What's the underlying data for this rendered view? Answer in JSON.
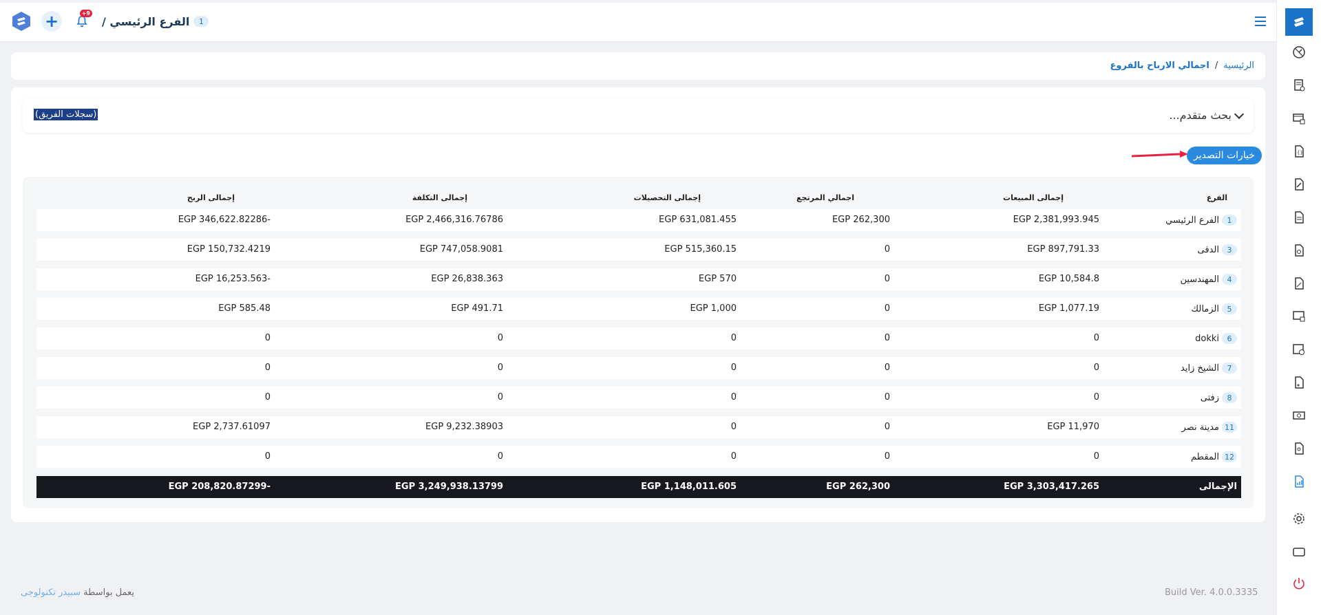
{
  "header": {
    "branch_number": "1",
    "branch_title": "الفرع الرئيسي /",
    "notification_count": "+9",
    "add_symbol": "+"
  },
  "breadcrumb": {
    "home": "الرئيسية",
    "separator": "/",
    "current": "اجمالي الارباح بالفروع"
  },
  "search": {
    "advanced_label": "بحث متقدم...",
    "team_logs": "(سجلات الفريق)"
  },
  "export_button": "خيارات التصدير",
  "table": {
    "headers": {
      "branch": "الفرع",
      "sales": "إجمالى المبيعات",
      "returns": "اجمالي المرتجع",
      "collections": "إجمالى التحصيلات",
      "cost": "إجمالى التكلفة",
      "profit": "إجمالى الربح"
    },
    "rows": [
      {
        "num": "1",
        "branch": "الفرع الرئيسي",
        "sales": "EGP 2,381,993.945",
        "returns": "EGP 262,300",
        "collections": "EGP 631,081.455",
        "cost": "EGP 2,466,316.76786",
        "profit": "EGP 346,622.82286-"
      },
      {
        "num": "3",
        "branch": "الدقى",
        "sales": "EGP 897,791.33",
        "returns": "0",
        "collections": "EGP 515,360.15",
        "cost": "EGP 747,058.9081",
        "profit": "EGP 150,732.4219"
      },
      {
        "num": "4",
        "branch": "المهندسين",
        "sales": "EGP 10,584.8",
        "returns": "0",
        "collections": "EGP 570",
        "cost": "EGP 26,838.363",
        "profit": "EGP 16,253.563-"
      },
      {
        "num": "5",
        "branch": "الزمالك",
        "sales": "EGP 1,077.19",
        "returns": "0",
        "collections": "EGP 1,000",
        "cost": "EGP 491.71",
        "profit": "EGP 585.48"
      },
      {
        "num": "6",
        "branch": "dokki",
        "sales": "0",
        "returns": "0",
        "collections": "0",
        "cost": "0",
        "profit": "0"
      },
      {
        "num": "7",
        "branch": "الشيخ زايد",
        "sales": "0",
        "returns": "0",
        "collections": "0",
        "cost": "0",
        "profit": "0"
      },
      {
        "num": "8",
        "branch": "زفتى",
        "sales": "0",
        "returns": "0",
        "collections": "0",
        "cost": "0",
        "profit": "0"
      },
      {
        "num": "11",
        "branch": "مدينة نصر",
        "sales": "EGP 11,970",
        "returns": "0",
        "collections": "0",
        "cost": "EGP 9,232.38903",
        "profit": "EGP 2,737.61097"
      },
      {
        "num": "12",
        "branch": "المقطم",
        "sales": "0",
        "returns": "0",
        "collections": "0",
        "cost": "0",
        "profit": "0"
      }
    ],
    "total": {
      "label": "الإجمالى",
      "sales": "EGP 3,303,417.265",
      "returns": "EGP 262,300",
      "collections": "EGP 1,148,011.605",
      "cost": "EGP 3,249,938.13799",
      "profit": "EGP 208,820.87299-"
    }
  },
  "footer": {
    "powered_prefix": "يعمل بواسطة",
    "powered_link": "سبيدر تكنولوجى",
    "build": "Build Ver. 4.0.0.3335"
  },
  "sidebar_icons": [
    "speedometer-icon",
    "invoice-icon",
    "cash-register-icon",
    "document-bracket-icon",
    "document-edit-icon",
    "document-lines-icon",
    "document-tag-icon",
    "document-discount-icon",
    "monitor-icon",
    "image-settings-icon",
    "document-plus-icon",
    "money-icon",
    "document-user-icon",
    "chart-report-icon",
    "gear-icon",
    "rectangle-icon",
    "power-icon"
  ],
  "colors": {
    "accent": "#1a73c9",
    "total_row": "#17191e",
    "export_btn": "#2a8ae0",
    "power": "#e6233f"
  }
}
